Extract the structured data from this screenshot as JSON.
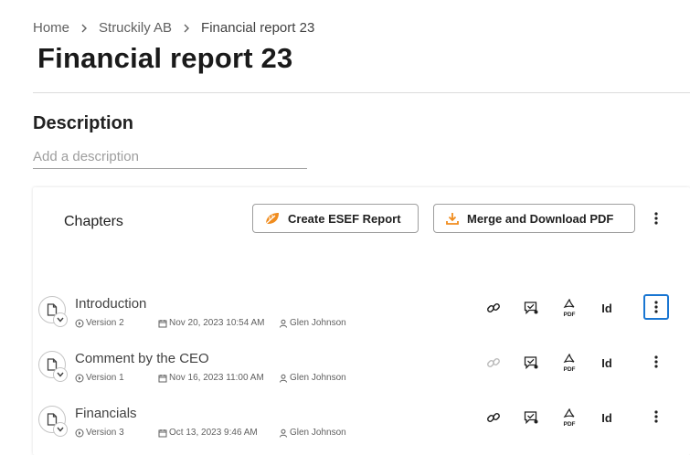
{
  "breadcrumb": {
    "items": [
      "Home",
      "Struckily AB",
      "Financial report 23"
    ]
  },
  "page": {
    "title": "Financial report 23"
  },
  "description": {
    "heading": "Description",
    "placeholder": "Add a description",
    "value": ""
  },
  "chapters": {
    "title": "Chapters",
    "create_esef_label": "Create ESEF Report",
    "merge_pdf_label": "Merge and Download PDF",
    "id_label": "Id",
    "rows": [
      {
        "title": "Introduction",
        "version": "Version 2",
        "date": "Nov 20, 2023 10:54 AM",
        "author": "Glen Johnson",
        "link_active": true,
        "focused": true
      },
      {
        "title": "Comment by the CEO",
        "version": "Version 1",
        "date": "Nov 16, 2023 11:00 AM",
        "author": "Glen Johnson",
        "link_active": false,
        "focused": false
      },
      {
        "title": "Financials",
        "version": "Version 3",
        "date": "Oct 13, 2023 9:46 AM",
        "author": "Glen Johnson",
        "link_active": true,
        "focused": false
      }
    ]
  },
  "colors": {
    "accent_orange": "#f08c1e",
    "focus_blue": "#1976d2",
    "icon_dark": "#212121",
    "icon_disabled": "#bdbdbd"
  },
  "icons": {
    "breadcrumb_separator": "chevron-right-icon",
    "esef": "leaf-icon",
    "merge": "download-icon",
    "chapter": "document-icon",
    "expand": "chevron-down-icon",
    "link": "link-icon",
    "comment": "comment-check-icon",
    "pdf": "pdf-icon",
    "more": "more-vertical-icon"
  }
}
